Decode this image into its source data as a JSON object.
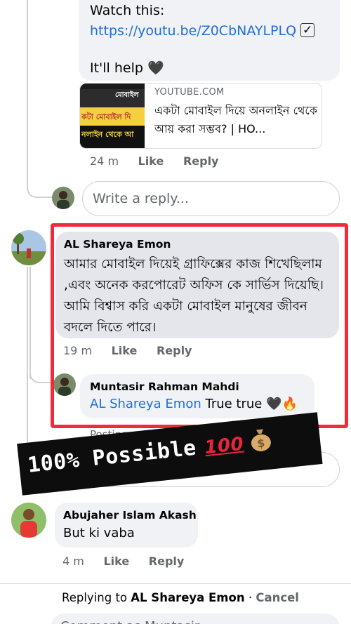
{
  "comment_top": {
    "line1": "Watch this:",
    "link": "https://youtu.be/Z0CbNAYLPLQ",
    "line3": "It'll help",
    "heart_emoji": "🖤",
    "preview": {
      "domain": "YOUTUBE.COM",
      "title": "একটা মোবাইল দিয়ে অনলাইন থেকে আয় করা সম্ভব? | HO...",
      "thumb_text1": "মোবাইল",
      "thumb_text2": "কটা মোবাইল দি",
      "thumb_text3": "নলাইন থেকে আ"
    },
    "time": "24 m",
    "like": "Like",
    "reply": "Reply"
  },
  "reply_input": {
    "placeholder": "Write a reply..."
  },
  "comment_emon": {
    "name": "AL Shareya Emon",
    "text": "আমার মোবাইল দিয়েই গ্রাফিক্সের কাজ শিখেছিলাম ,এবং অনেক করপোরেট অফিস কে সার্ভিস দিয়েছি।আমি বিশ্বাস করি একটা মোবাইল মানুষের জীবন বদলে দিতে পারে।",
    "time": "19 m",
    "like": "Like",
    "reply": "Reply"
  },
  "reply_mahdi": {
    "name": "Muntasir Rahman Mahdi",
    "mention": "AL Shareya Emon",
    "text": " True true 🖤🔥"
  },
  "posting_label": "Posting...",
  "banner": {
    "text": "100% Possible",
    "emoji_100": "100"
  },
  "comment_akash": {
    "name": "Abujaher Islam Akash",
    "text": "But ki vaba",
    "time": "4 m",
    "like": "Like",
    "reply": "Reply"
  },
  "reply_bar": {
    "prefix": "Replying to ",
    "target": "AL Shareya Emon",
    "separator": " · ",
    "cancel": "Cancel",
    "composer_placeholder": "Comment as Muntasir"
  },
  "colors": {
    "link": "#216fdb",
    "highlight_box": "#ef2d3a",
    "bubble": "#f0f2f5",
    "muted": "#65676b"
  }
}
